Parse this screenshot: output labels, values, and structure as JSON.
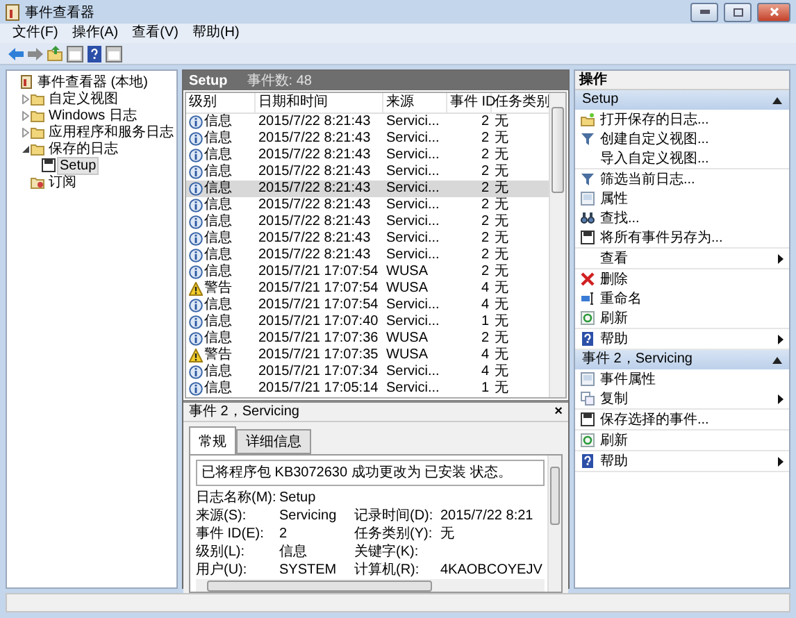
{
  "window": {
    "title": "事件查看器"
  },
  "menu": [
    "文件(F)",
    "操作(A)",
    "查看(V)",
    "帮助(H)"
  ],
  "tree": [
    {
      "label": "事件查看器 (本地)",
      "kind": "root",
      "selected": false,
      "children": [
        {
          "label": "自定义视图",
          "kind": "folder",
          "expanded": false,
          "selected": false
        },
        {
          "label": "Windows 日志",
          "kind": "folder",
          "expanded": false,
          "selected": false
        },
        {
          "label": "应用程序和服务日志",
          "kind": "folder",
          "expanded": false,
          "selected": false
        },
        {
          "label": "保存的日志",
          "kind": "folder",
          "expanded": true,
          "selected": false,
          "children": [
            {
              "label": "Setup",
              "kind": "log",
              "selected": true
            }
          ]
        },
        {
          "label": "订阅",
          "kind": "subscription",
          "selected": false
        }
      ]
    }
  ],
  "log_header": {
    "title": "Setup",
    "count": "事件数: 48"
  },
  "table": {
    "columns": [
      "级别",
      "日期和时间",
      "来源",
      "事件 ID",
      "任务类别"
    ],
    "rows": [
      {
        "kind": "info",
        "level": "信息",
        "datetime": "2015/7/22 8:21:43",
        "source": "Servici...",
        "event_id": "2",
        "task": "无",
        "selected": false
      },
      {
        "kind": "info",
        "level": "信息",
        "datetime": "2015/7/22 8:21:43",
        "source": "Servici...",
        "event_id": "2",
        "task": "无",
        "selected": false
      },
      {
        "kind": "info",
        "level": "信息",
        "datetime": "2015/7/22 8:21:43",
        "source": "Servici...",
        "event_id": "2",
        "task": "无",
        "selected": false
      },
      {
        "kind": "info",
        "level": "信息",
        "datetime": "2015/7/22 8:21:43",
        "source": "Servici...",
        "event_id": "2",
        "task": "无",
        "selected": false
      },
      {
        "kind": "info",
        "level": "信息",
        "datetime": "2015/7/22 8:21:43",
        "source": "Servici...",
        "event_id": "2",
        "task": "无",
        "selected": true
      },
      {
        "kind": "info",
        "level": "信息",
        "datetime": "2015/7/22 8:21:43",
        "source": "Servici...",
        "event_id": "2",
        "task": "无",
        "selected": false
      },
      {
        "kind": "info",
        "level": "信息",
        "datetime": "2015/7/22 8:21:43",
        "source": "Servici...",
        "event_id": "2",
        "task": "无",
        "selected": false
      },
      {
        "kind": "info",
        "level": "信息",
        "datetime": "2015/7/22 8:21:43",
        "source": "Servici...",
        "event_id": "2",
        "task": "无",
        "selected": false
      },
      {
        "kind": "info",
        "level": "信息",
        "datetime": "2015/7/22 8:21:43",
        "source": "Servici...",
        "event_id": "2",
        "task": "无",
        "selected": false
      },
      {
        "kind": "info",
        "level": "信息",
        "datetime": "2015/7/21 17:07:54",
        "source": "WUSA",
        "event_id": "2",
        "task": "无",
        "selected": false
      },
      {
        "kind": "warning",
        "level": "警告",
        "datetime": "2015/7/21 17:07:54",
        "source": "WUSA",
        "event_id": "4",
        "task": "无",
        "selected": false
      },
      {
        "kind": "info",
        "level": "信息",
        "datetime": "2015/7/21 17:07:54",
        "source": "Servici...",
        "event_id": "4",
        "task": "无",
        "selected": false
      },
      {
        "kind": "info",
        "level": "信息",
        "datetime": "2015/7/21 17:07:40",
        "source": "Servici...",
        "event_id": "1",
        "task": "无",
        "selected": false
      },
      {
        "kind": "info",
        "level": "信息",
        "datetime": "2015/7/21 17:07:36",
        "source": "WUSA",
        "event_id": "2",
        "task": "无",
        "selected": false
      },
      {
        "kind": "warning",
        "level": "警告",
        "datetime": "2015/7/21 17:07:35",
        "source": "WUSA",
        "event_id": "4",
        "task": "无",
        "selected": false
      },
      {
        "kind": "info",
        "level": "信息",
        "datetime": "2015/7/21 17:07:34",
        "source": "Servici...",
        "event_id": "4",
        "task": "无",
        "selected": false
      },
      {
        "kind": "info",
        "level": "信息",
        "datetime": "2015/7/21 17:05:14",
        "source": "Servici...",
        "event_id": "1",
        "task": "无",
        "selected": false
      }
    ]
  },
  "detail": {
    "title": "事件 2，Servicing",
    "close": "×",
    "tabs": [
      {
        "label": "常规",
        "selected": true
      },
      {
        "label": "详细信息",
        "selected": false
      }
    ],
    "message": "已将程序包 KB3072630 成功更改为 已安装 状态。",
    "fields": [
      {
        "label": "日志名称(M):",
        "value": "Setup"
      },
      {
        "label": "来源(S):",
        "value": "Servicing",
        "label2": "记录时间(D):",
        "value2": "2015/7/22 8:21"
      },
      {
        "label": "事件 ID(E):",
        "value": "2",
        "label2": "任务类别(Y):",
        "value2": "无"
      },
      {
        "label": "级别(L):",
        "value": "信息",
        "label2": "关键字(K):"
      },
      {
        "label": "用户(U):",
        "value": "SYSTEM",
        "label2": "计算机(R):",
        "value2": "4KAOBCOYEJV"
      }
    ]
  },
  "actions": {
    "title": "操作",
    "sections": [
      {
        "title": "Setup",
        "expanded": true,
        "groups": [
          [
            {
              "label": "打开保存的日志...",
              "kind": "open"
            },
            {
              "label": "创建自定义视图...",
              "kind": "filter"
            },
            {
              "label": "导入自定义视图...",
              "kind": "none"
            }
          ],
          [
            {
              "label": "筛选当前日志...",
              "kind": "filter"
            },
            {
              "label": "属性",
              "kind": "properties"
            },
            {
              "label": "查找...",
              "kind": "find"
            },
            {
              "label": "将所有事件另存为...",
              "kind": "save"
            }
          ],
          [
            {
              "label": "查看",
              "kind": "none",
              "submenu": true
            }
          ],
          [
            {
              "label": "删除",
              "kind": "delete"
            },
            {
              "label": "重命名",
              "kind": "rename"
            },
            {
              "label": "刷新",
              "kind": "refresh"
            }
          ],
          [
            {
              "label": "帮助",
              "kind": "help",
              "submenu": true
            }
          ]
        ]
      },
      {
        "title": "事件 2，Servicing",
        "expanded": true,
        "groups": [
          [
            {
              "label": "事件属性",
              "kind": "properties"
            },
            {
              "label": "复制",
              "kind": "copy",
              "submenu": true
            }
          ],
          [
            {
              "label": "保存选择的事件...",
              "kind": "save"
            }
          ],
          [
            {
              "label": "刷新",
              "kind": "refresh"
            }
          ],
          [
            {
              "label": "帮助",
              "kind": "help",
              "submenu": true
            }
          ]
        ]
      }
    ]
  }
}
